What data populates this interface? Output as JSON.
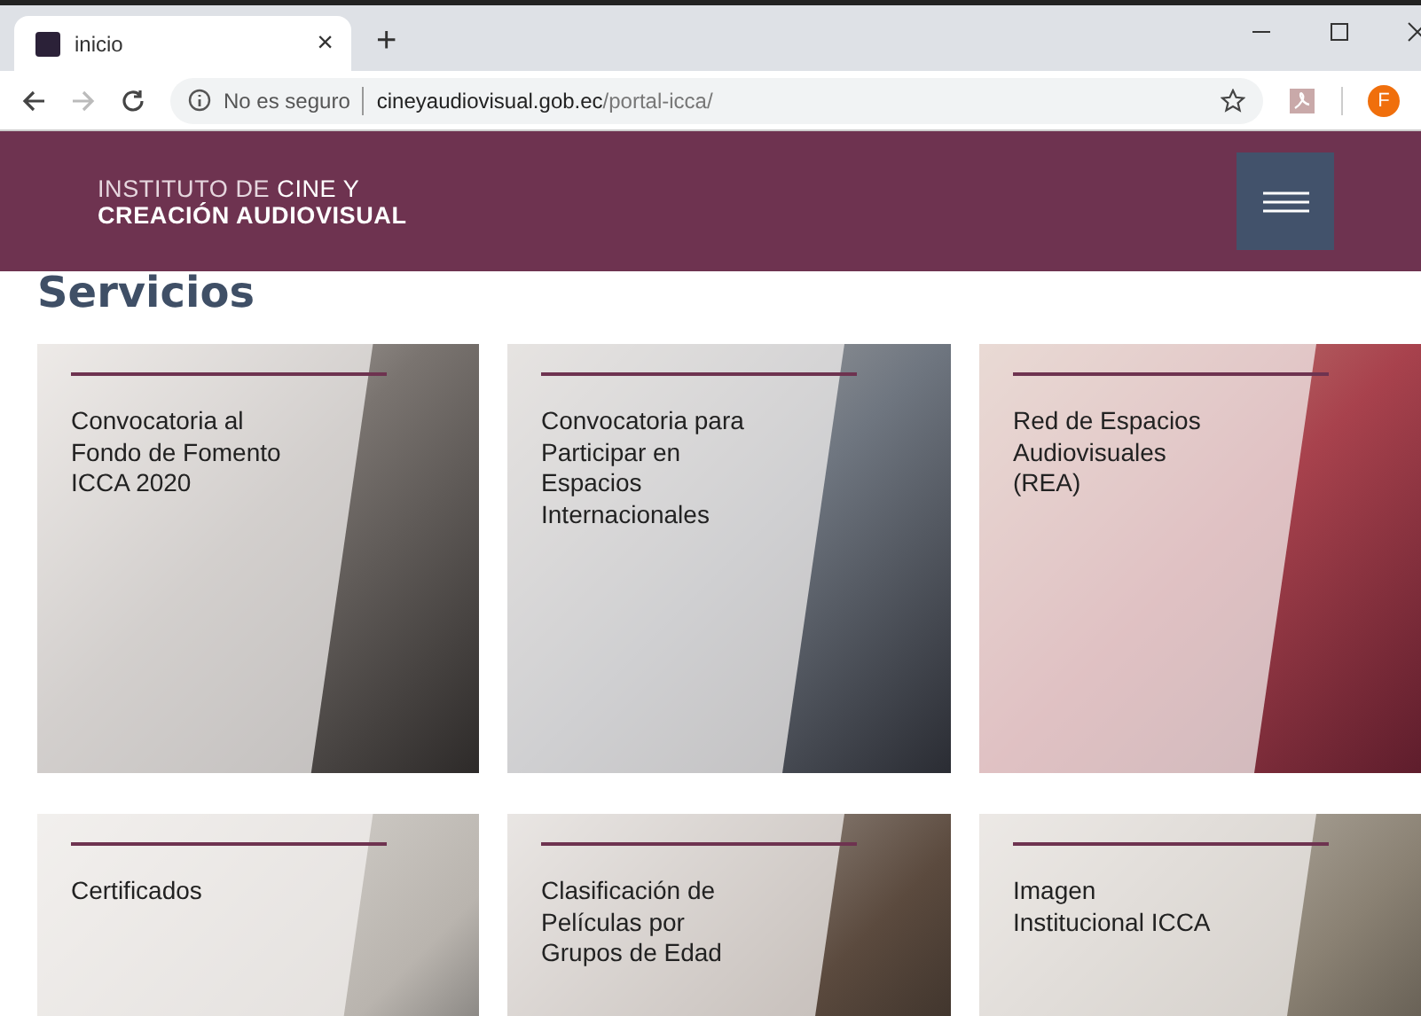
{
  "browser": {
    "tab": {
      "title": "inicio",
      "close": "×"
    },
    "new_tab": "+",
    "address": {
      "security": "No es seguro",
      "domain": "cineyaudiovisual.gob.ec",
      "path": "/portal-icca/"
    },
    "profile": "F"
  },
  "header": {
    "logo_lines": [
      "INSTITUTO DE **CINE Y**",
      "CREACIÓN AUDIOVISUAL"
    ]
  },
  "heading": "Servicios",
  "cards": [
    {
      "lines": [
        "Convocatoria al",
        "Fondo de Fomento",
        "ICCA 2020"
      ]
    },
    {
      "lines": [
        "Convocatoria para",
        "Participar en",
        "Espacios",
        "Internacionales"
      ]
    },
    {
      "lines": [
        "Red de Espacios",
        "Audiovisuales",
        "(REA)"
      ]
    },
    {
      "lines": [
        "Certificados"
      ]
    },
    {
      "lines": [
        "Clasificación de",
        "Películas por",
        "Grupos de Edad"
      ]
    },
    {
      "lines": [
        "Imagen",
        "Institucional ICCA"
      ]
    }
  ]
}
